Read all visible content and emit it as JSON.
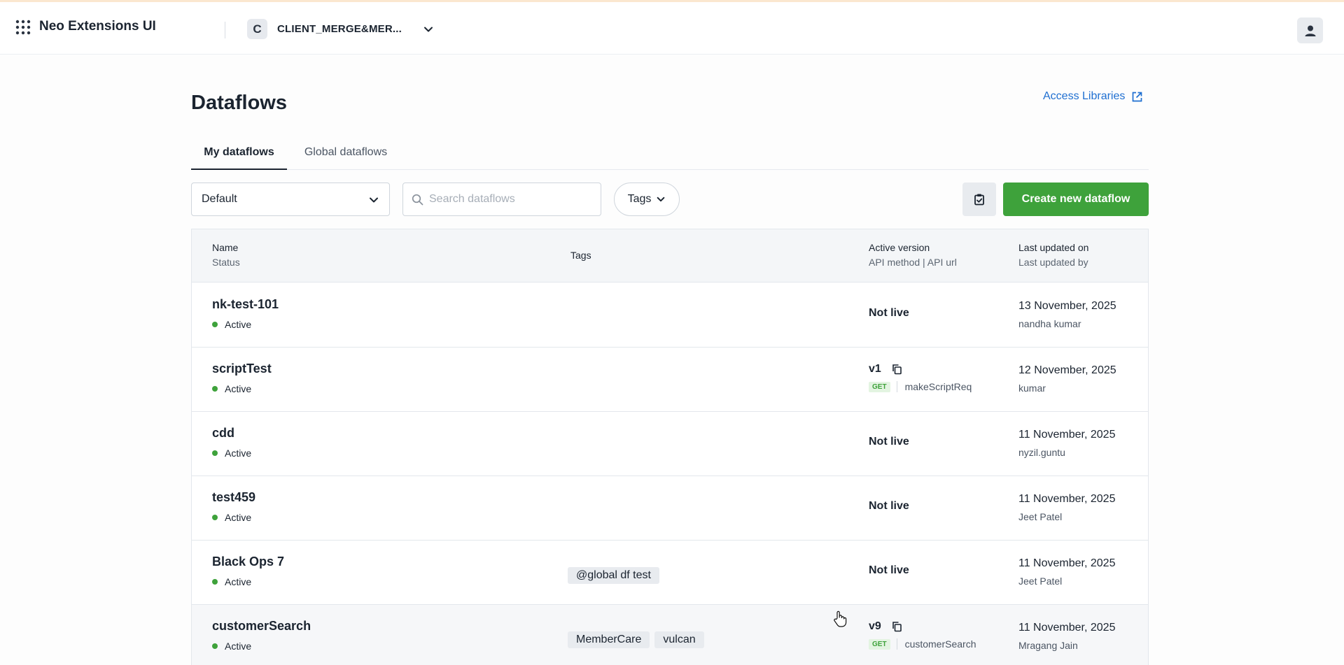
{
  "app": {
    "title": "Neo Extensions UI"
  },
  "client": {
    "initial": "C",
    "name": "CLIENT_MERGE&MER..."
  },
  "page": {
    "title": "Dataflows",
    "access_libraries": "Access Libraries"
  },
  "tabs": [
    {
      "label": "My dataflows",
      "active": true
    },
    {
      "label": "Global dataflows",
      "active": false
    }
  ],
  "filters": {
    "workspace": "Default",
    "search_placeholder": "Search dataflows",
    "tags_label": "Tags",
    "create_label": "Create new dataflow"
  },
  "table": {
    "headers": {
      "name": "Name",
      "status": "Status",
      "tags": "Tags",
      "version": "Active version",
      "api": "API method | API url",
      "updated_on": "Last updated on",
      "updated_by": "Last updated by"
    },
    "rows": [
      {
        "name": "nk-test-101",
        "status": "Active",
        "tags": [],
        "version": "Not live",
        "method": "",
        "api_url": "",
        "date": "13 November, 2025",
        "by": "nandha kumar"
      },
      {
        "name": "scriptTest",
        "status": "Active",
        "tags": [],
        "version": "v1",
        "method": "GET",
        "api_url": "makeScriptReq",
        "date": "12 November, 2025",
        "by": "kumar"
      },
      {
        "name": "cdd",
        "status": "Active",
        "tags": [],
        "version": "Not live",
        "method": "",
        "api_url": "",
        "date": "11 November, 2025",
        "by": "nyzil.guntu"
      },
      {
        "name": "test459",
        "status": "Active",
        "tags": [],
        "version": "Not live",
        "method": "",
        "api_url": "",
        "date": "11 November, 2025",
        "by": "Jeet Patel"
      },
      {
        "name": "Black Ops 7",
        "status": "Active",
        "tags": [
          "@global df test"
        ],
        "version": "Not live",
        "method": "",
        "api_url": "",
        "date": "11 November, 2025",
        "by": "Jeet Patel"
      },
      {
        "name": "customerSearch",
        "status": "Active",
        "tags": [
          "MemberCare",
          "vulcan"
        ],
        "version": "v9",
        "method": "GET",
        "api_url": "customerSearch",
        "date": "11 November, 2025",
        "by": "Mragang Jain"
      }
    ]
  },
  "colors": {
    "primary": "#3ea23b",
    "link": "#1f6fd1",
    "status_active": "#3ea23b"
  }
}
